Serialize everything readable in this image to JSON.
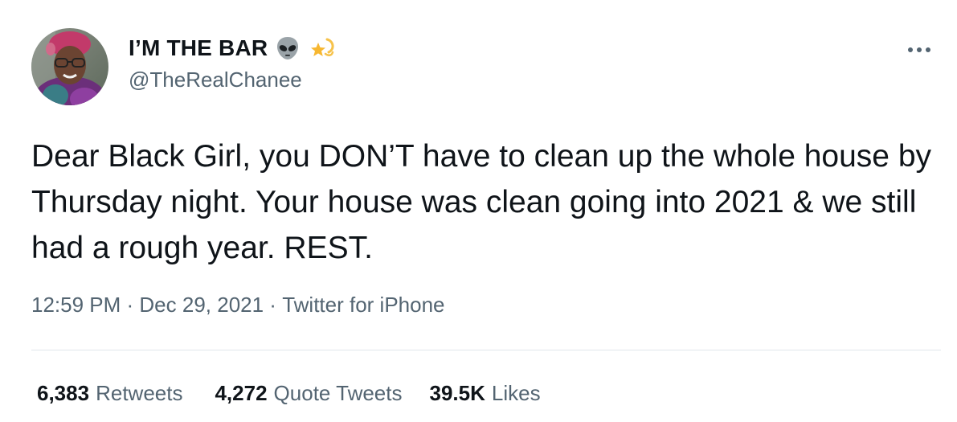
{
  "user": {
    "display_name": "I’M THE BAR",
    "handle": "@TheRealChanee",
    "name_emojis": [
      "alien-emoji",
      "dizzy-star-emoji"
    ]
  },
  "tweet": {
    "text": "Dear Black Girl, you DON’T have to clean up the whole house by Thursday night. Your house was clean going into 2021 & we still had a rough year. REST.",
    "time": "12:59 PM",
    "date": "Dec 29, 2021",
    "source": "Twitter for iPhone",
    "separator": " · "
  },
  "stats": {
    "retweets_count": "6,383",
    "retweets_label": "Retweets",
    "quotes_count": "4,272",
    "quotes_label": "Quote Tweets",
    "likes_count": "39.5K",
    "likes_label": "Likes"
  },
  "colors": {
    "text": "#0f1419",
    "secondary": "#536471",
    "divider": "#e1e6ea"
  },
  "icons": {
    "more": "more-horizontal-icon"
  }
}
